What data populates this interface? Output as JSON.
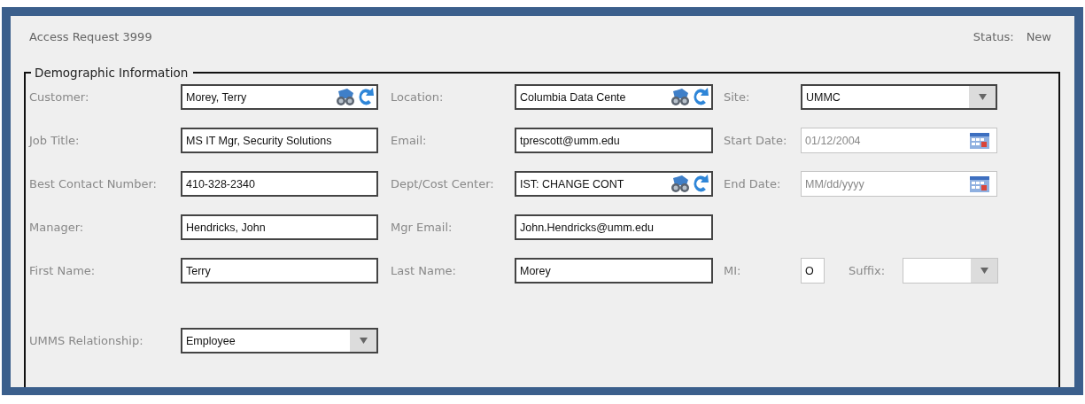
{
  "header": {
    "title": "Access Request 3999",
    "status_label": "Status:",
    "status_value": "New"
  },
  "section": {
    "legend": "Demographic Information",
    "rows": [
      [
        {
          "label": "Customer:",
          "kind": "lookup",
          "value": "Morey, Terry",
          "required": true
        },
        {
          "label": "Location:",
          "kind": "lookup",
          "value": "Columbia Data Cente",
          "required": true
        },
        {
          "label": "Site:",
          "kind": "dropdown",
          "value": "UMMC",
          "required": true
        }
      ],
      [
        {
          "label": "Job Title:",
          "kind": "text",
          "value": "MS IT Mgr, Security Solutions",
          "required": true
        },
        {
          "label": "Email:",
          "kind": "text",
          "value": "tprescott@umm.edu",
          "required": true
        },
        {
          "label": "Start Date:",
          "kind": "date",
          "value": "01/12/2004",
          "required": false
        }
      ],
      [
        {
          "label": "Best Contact Number:",
          "kind": "text",
          "value": "410-328-2340",
          "required": true
        },
        {
          "label": "Dept/Cost Center:",
          "kind": "lookup",
          "value": "IST: CHANGE CONT",
          "required": true
        },
        {
          "label": "End Date:",
          "kind": "date",
          "placeholder": "MM/dd/yyyy",
          "required": false
        }
      ],
      [
        {
          "label": "Manager:",
          "kind": "text",
          "value": "Hendricks, John",
          "required": true
        },
        {
          "label": "Mgr Email:",
          "kind": "text",
          "value": "John.Hendricks@umm.edu",
          "required": true
        }
      ],
      [
        {
          "label": "First Name:",
          "kind": "text",
          "value": "Terry",
          "required": true
        },
        {
          "label": "Last Name:",
          "kind": "text",
          "value": "Morey",
          "required": true
        },
        {
          "label": "MI:",
          "kind": "initial",
          "value": "O",
          "required": false
        },
        {
          "label": "Suffix:",
          "kind": "dropdown",
          "required": false
        }
      ],
      [
        {
          "label": "UMMS Relationship:",
          "kind": "dropdown",
          "value": "Employee",
          "required": true
        }
      ]
    ]
  }
}
